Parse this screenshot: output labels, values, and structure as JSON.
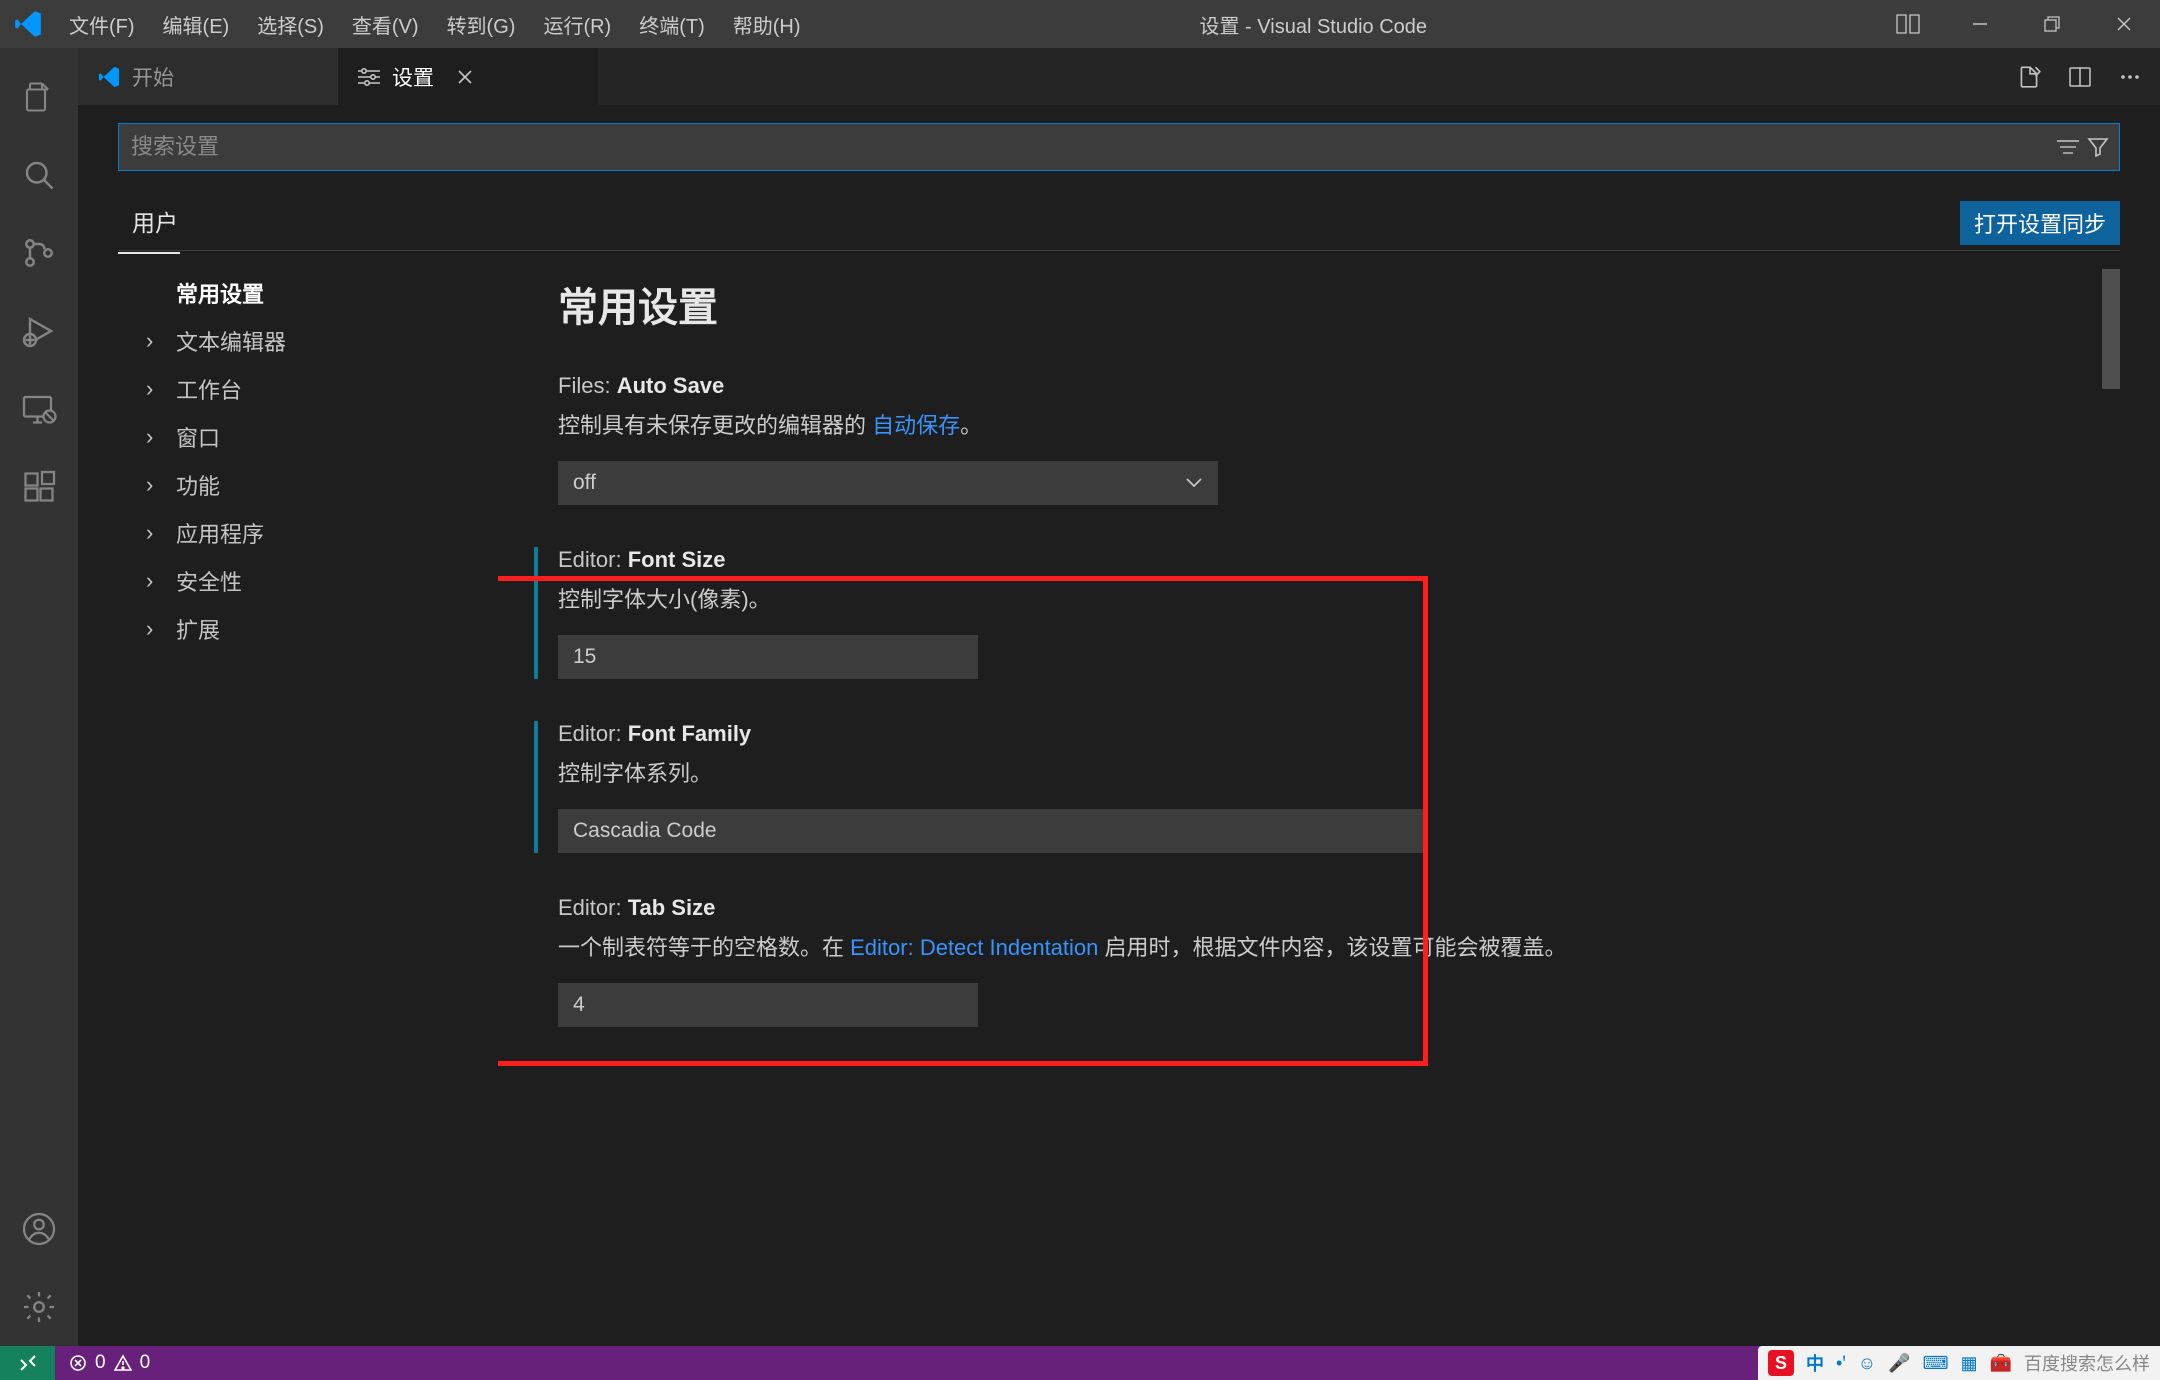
{
  "window": {
    "title": "设置 - Visual Studio Code"
  },
  "menu": [
    "文件(F)",
    "编辑(E)",
    "选择(S)",
    "查看(V)",
    "转到(G)",
    "运行(R)",
    "终端(T)",
    "帮助(H)"
  ],
  "tabs": {
    "welcome": "开始",
    "settings": "设置"
  },
  "search": {
    "placeholder": "搜索设置"
  },
  "scope": {
    "user": "用户",
    "sync": "打开设置同步"
  },
  "toc": {
    "items": [
      {
        "label": "常用设置",
        "sel": true,
        "chev": ""
      },
      {
        "label": "文本编辑器",
        "chev": "›"
      },
      {
        "label": "工作台",
        "chev": "›"
      },
      {
        "label": "窗口",
        "chev": "›"
      },
      {
        "label": "功能",
        "chev": "›"
      },
      {
        "label": "应用程序",
        "chev": "›"
      },
      {
        "label": "安全性",
        "chev": "›"
      },
      {
        "label": "扩展",
        "chev": "›"
      }
    ]
  },
  "section_title": "常用设置",
  "settings": {
    "autoSave": {
      "cat": "Files:",
      "name": "Auto Save",
      "desc_pre": "控制具有未保存更改的编辑器的 ",
      "desc_link": "自动保存",
      "desc_post": "。",
      "value": "off"
    },
    "fontSize": {
      "cat": "Editor:",
      "name": "Font Size",
      "desc": "控制字体大小(像素)。",
      "value": "15"
    },
    "fontFamily": {
      "cat": "Editor:",
      "name": "Font Family",
      "desc": "控制字体系列。",
      "value": "Cascadia Code"
    },
    "tabSize": {
      "cat": "Editor:",
      "name": "Tab Size",
      "desc_pre": "一个制表符等于的空格数。在 ",
      "desc_link": "Editor: Detect Indentation",
      "desc_post": " 启用时，根据文件内容，该设置可能会被覆盖。",
      "value": "4"
    }
  },
  "status": {
    "errors": "0",
    "warnings": "0"
  },
  "ime": {
    "lang": "中",
    "tip": "百度搜索怎么样"
  }
}
